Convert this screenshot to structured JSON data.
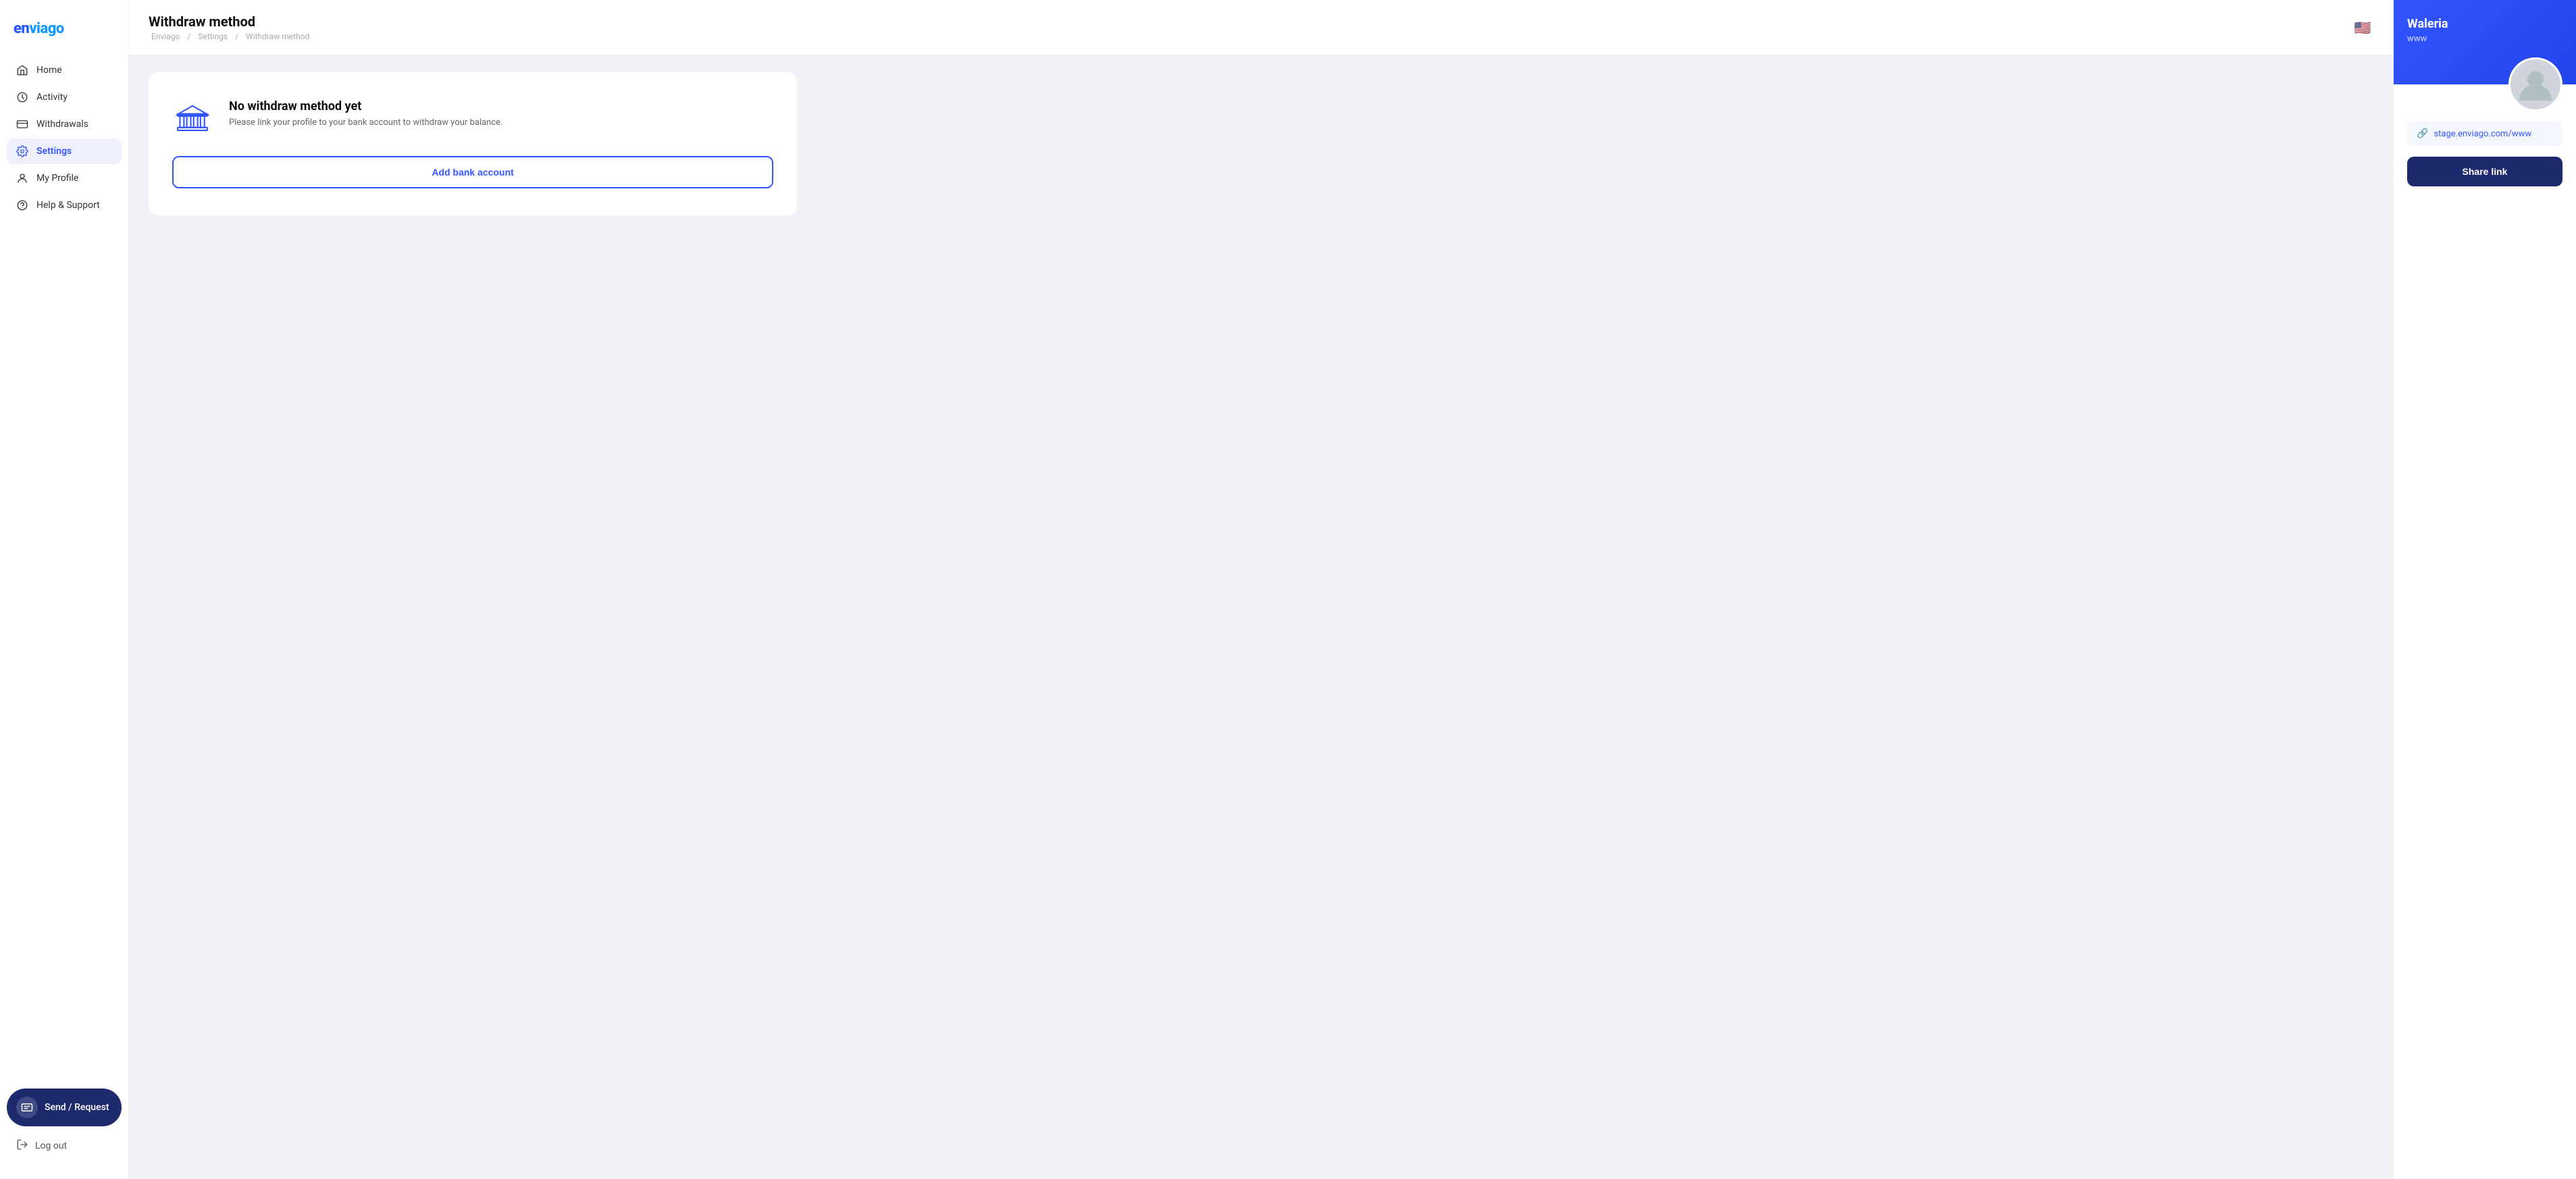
{
  "app": {
    "logo": "enviago",
    "logo_color_e": "en",
    "logo_color_rest": "viago"
  },
  "sidebar": {
    "nav_items": [
      {
        "id": "home",
        "label": "Home",
        "active": false
      },
      {
        "id": "activity",
        "label": "Activity",
        "active": false
      },
      {
        "id": "withdrawals",
        "label": "Withdrawals",
        "active": false
      },
      {
        "id": "settings",
        "label": "Settings",
        "active": true
      },
      {
        "id": "my-profile",
        "label": "My Profile",
        "active": false
      },
      {
        "id": "help-support",
        "label": "Help & Support",
        "active": false
      }
    ],
    "send_request_label": "Send / Request",
    "logout_label": "Log out"
  },
  "header": {
    "title": "Withdraw method",
    "breadcrumb": {
      "items": [
        "Enviago",
        "Settings",
        "Withdraw method"
      ],
      "separator": "/"
    },
    "flag": "🇺🇸"
  },
  "main": {
    "card": {
      "empty_title": "No withdraw method yet",
      "empty_description": "Please link your profile to your bank account to withdraw your balance.",
      "add_button_label": "Add bank account"
    }
  },
  "right_panel": {
    "user_name": "Waleria",
    "user_handle": "www",
    "profile_url": "stage.enviago.com/www",
    "share_button_label": "Share link"
  }
}
